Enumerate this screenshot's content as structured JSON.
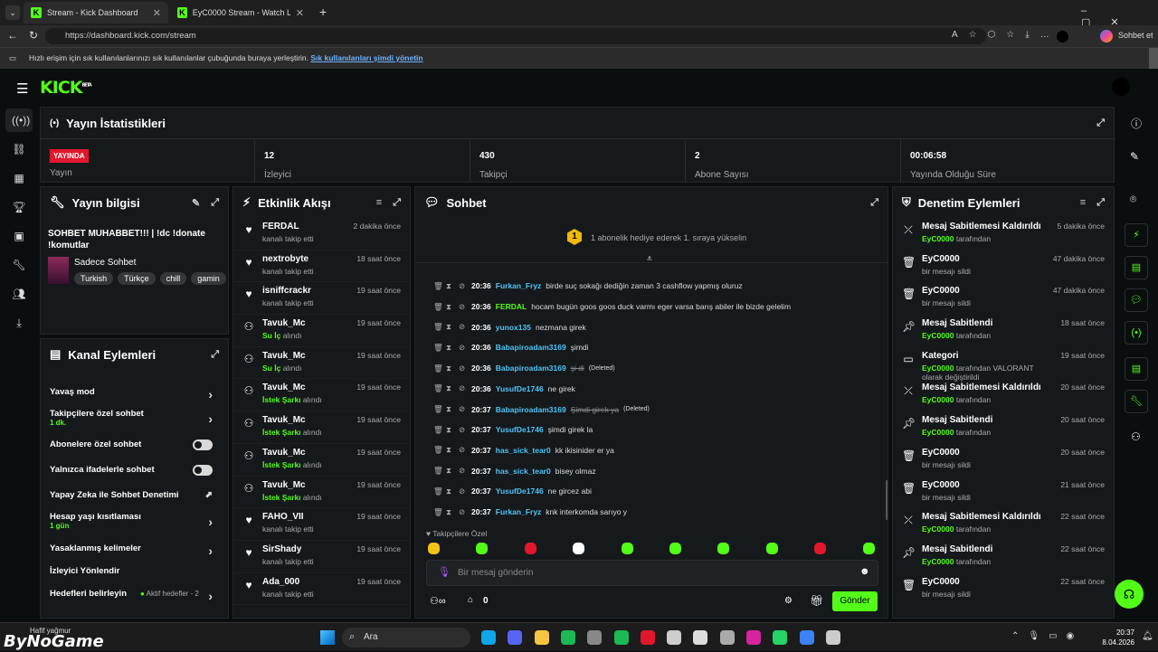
{
  "browser": {
    "tab1": "Stream - Kick Dashboard",
    "tab2": "EyC0000 Stream - Watch Live on K",
    "url": "https://dashboard.kick.com/stream",
    "copilot": "Sohbet et",
    "bookmarks_text": "Hızlı erişim için sık kullanılanlarınızı sık kullanılanlar çubuğunda buraya yerleştirin.",
    "bookmarks_link": "Sık kullanılanları şimdi yönetin"
  },
  "logo": "KICK",
  "logo_badge": "BETA",
  "stats": {
    "title": "Yayın İstatistikleri",
    "status_badge": "YAYINDA",
    "status_label": "Yayın",
    "viewers": "12",
    "viewers_label": "İzleyici",
    "followers": "430",
    "followers_label": "Takipçi",
    "subs": "2",
    "subs_label": "Abone Sayısı",
    "uptime": "00:06:58",
    "uptime_label": "Yayında Olduğu Süre"
  },
  "info": {
    "title": "Yayın bilgisi",
    "stream_title": "SOHBET MUHABBET!!! | !dc !donate !komutlar",
    "category": "Sadece Sohbet",
    "tags": [
      "Turkish",
      "Türkçe",
      "chill",
      "gamin"
    ]
  },
  "channel": {
    "title": "Kanal Eylemleri",
    "slow": "Yavaş mod",
    "followers_only": "Takipçilere özel sohbet",
    "followers_only_val": "1 dk.",
    "subs_only": "Abonelere özel sohbet",
    "emote_only": "Yalnızca ifadelerle sohbet",
    "ai_mod": "Yapay Zeka ile Sohbet Denetimi",
    "account_age": "Hesap yaşı kısıtlaması",
    "account_age_val": "1 gün",
    "banned_words": "Yasaklanmış kelimeler",
    "redirect": "İzleyici Yönlendir",
    "goals": "Hedefleri belirleyin",
    "goals_val": "Aktif hedefler - 2"
  },
  "activity": {
    "title": "Etkinlik Akışı",
    "items": [
      {
        "name": "FERDAL",
        "sub": "kanalı takip etti",
        "hl": "",
        "time": "2 dakika önce",
        "icon": "heart"
      },
      {
        "name": "nextrobyte",
        "sub": "kanalı takip etti",
        "hl": "",
        "time": "18 saat önce",
        "icon": "heart"
      },
      {
        "name": "isniffcrackr",
        "sub": "kanalı takip etti",
        "hl": "",
        "time": "19 saat önce",
        "icon": "heart"
      },
      {
        "name": "Tavuk_Mc",
        "sub": "alındı",
        "hl": "Su İç",
        "time": "19 saat önce",
        "icon": "points"
      },
      {
        "name": "Tavuk_Mc",
        "sub": "alındı",
        "hl": "Su İç",
        "time": "19 saat önce",
        "icon": "points"
      },
      {
        "name": "Tavuk_Mc",
        "sub": "alındı",
        "hl": "İstek Şarkı",
        "time": "19 saat önce",
        "icon": "points"
      },
      {
        "name": "Tavuk_Mc",
        "sub": "alındı",
        "hl": "İstek Şarkı",
        "time": "19 saat önce",
        "icon": "points"
      },
      {
        "name": "Tavuk_Mc",
        "sub": "alındı",
        "hl": "İstek Şarkı",
        "time": "19 saat önce",
        "icon": "points"
      },
      {
        "name": "Tavuk_Mc",
        "sub": "alındı",
        "hl": "İstek Şarkı",
        "time": "19 saat önce",
        "icon": "points"
      },
      {
        "name": "FAHO_VII",
        "sub": "kanalı takip etti",
        "hl": "",
        "time": "19 saat önce",
        "icon": "heart"
      },
      {
        "name": "SirShady",
        "sub": "kanalı takip etti",
        "hl": "",
        "time": "19 saat önce",
        "icon": "heart"
      },
      {
        "name": "Ada_000",
        "sub": "kanalı takip etti",
        "hl": "",
        "time": "19 saat önce",
        "icon": "heart"
      }
    ]
  },
  "chat": {
    "title": "Sohbet",
    "gift_rank": "1",
    "gift_text": "1 abonelik hediye ederek 1. sıraya yükselin",
    "lines": [
      {
        "time": "20:36",
        "user": "Furkan_Fryz",
        "color": "#4fc3f7",
        "msg": "birde suç sokağı dediğin zaman 3 cashflow yapmış oluruz",
        "del": false
      },
      {
        "time": "20:36",
        "user": "FERDAL",
        "color": "#53fc18",
        "msg": "hocam bugün goos goos duck varmı eger varsa barış abiler ile bizde gelelim",
        "del": false
      },
      {
        "time": "20:36",
        "user": "yunox135",
        "color": "#4fc3f7",
        "msg": "nezmana girek",
        "del": false
      },
      {
        "time": "20:36",
        "user": "Babapiroadam3169",
        "color": "#4fc3f7",
        "msg": "şimdi",
        "del": false
      },
      {
        "time": "20:36",
        "user": "Babapiroadam3169",
        "color": "#4fc3f7",
        "msg": "şi di",
        "del": true
      },
      {
        "time": "20:36",
        "user": "YusufDe1746",
        "color": "#4fc3f7",
        "msg": "ne girek",
        "del": false
      },
      {
        "time": "20:37",
        "user": "Babapiroadam3169",
        "color": "#4fc3f7",
        "msg": "Şimdi girek ya",
        "del": true
      },
      {
        "time": "20:37",
        "user": "YusufDe1746",
        "color": "#4fc3f7",
        "msg": "şimdi girek la",
        "del": false
      },
      {
        "time": "20:37",
        "user": "has_sick_tear0",
        "color": "#4fc3f7",
        "msg": "kk ikisinider er ya",
        "del": false
      },
      {
        "time": "20:37",
        "user": "has_sick_tear0",
        "color": "#4fc3f7",
        "msg": "bisey olmaz",
        "del": false
      },
      {
        "time": "20:37",
        "user": "YusufDe1746",
        "color": "#4fc3f7",
        "msg": "ne gircez abi",
        "del": false
      },
      {
        "time": "20:37",
        "user": "Furkan_Fryz",
        "color": "#4fc3f7",
        "msg": "knk interkomda sarıyo y",
        "del": false
      }
    ],
    "deleted_label": "(Deleted)",
    "followers_emotes": "Takipçilere Özel",
    "placeholder": "Bir mesaj gönderin",
    "points": "0",
    "send": "Gönder"
  },
  "mod": {
    "title": "Denetim Eylemleri",
    "items": [
      {
        "name": "Mesaj Sabitlemesi Kaldırıldı",
        "hl": "EyC0000",
        "sub": "tarafından",
        "time": "5 dakika önce",
        "icon": "unpin"
      },
      {
        "name": "EyC0000",
        "hl": "",
        "sub": "bir mesajı sildi",
        "time": "47 dakika önce",
        "icon": "trash"
      },
      {
        "name": "EyC0000",
        "hl": "",
        "sub": "bir mesajı sildi",
        "time": "47 dakika önce",
        "icon": "trash"
      },
      {
        "name": "Mesaj Sabitlendi",
        "hl": "EyC0000",
        "sub": "tarafından",
        "time": "18 saat önce",
        "icon": "pin"
      },
      {
        "name": "Kategori",
        "hl": "EyC0000",
        "sub": "tarafından VALORANT olarak değiştirildi",
        "time": "19 saat önce",
        "icon": "cat"
      },
      {
        "name": "Mesaj Sabitlemesi Kaldırıldı",
        "hl": "EyC0000",
        "sub": "tarafından",
        "time": "20 saat önce",
        "icon": "unpin"
      },
      {
        "name": "Mesaj Sabitlendi",
        "hl": "EyC0000",
        "sub": "tarafından",
        "time": "20 saat önce",
        "icon": "pin"
      },
      {
        "name": "EyC0000",
        "hl": "",
        "sub": "bir mesajı sildi",
        "time": "20 saat önce",
        "icon": "trash"
      },
      {
        "name": "EyC0000",
        "hl": "",
        "sub": "bir mesajı sildi",
        "time": "21 saat önce",
        "icon": "trash"
      },
      {
        "name": "Mesaj Sabitlemesi Kaldırıldı",
        "hl": "EyC0000",
        "sub": "tarafından",
        "time": "22 saat önce",
        "icon": "unpin"
      },
      {
        "name": "Mesaj Sabitlendi",
        "hl": "EyC0000",
        "sub": "tarafından",
        "time": "22 saat önce",
        "icon": "pin"
      },
      {
        "name": "EyC0000",
        "hl": "",
        "sub": "bir mesajı sildi",
        "time": "22 saat önce",
        "icon": "trash"
      }
    ]
  },
  "taskbar": {
    "weather": "Hafif yağmur",
    "search": "Ara",
    "time": "20:37",
    "date": "8.04.2026",
    "watermark": "ByNoGame"
  }
}
